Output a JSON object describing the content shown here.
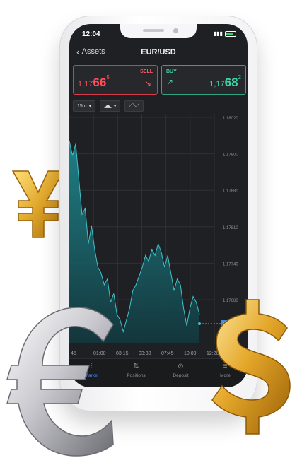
{
  "status": {
    "time": "12:04"
  },
  "nav": {
    "back_label": "Assets",
    "title": "EUR/USD"
  },
  "sell": {
    "label": "SELL",
    "price_prefix": "1,17",
    "price_big": "66",
    "price_sup": "5"
  },
  "buy": {
    "label": "BUY",
    "price_prefix": "1,17",
    "price_big": "68",
    "price_sup": "2"
  },
  "toolbar": {
    "interval": "15m"
  },
  "chart_data": {
    "type": "area",
    "y_ticks": [
      "1.18020",
      "1.17900",
      "1.17880",
      "1.17810",
      "1.17740",
      "1.17680"
    ],
    "x_ticks": [
      "45",
      "01:00",
      "03:15",
      "03:30",
      "07:45",
      "10:09",
      "12:20"
    ],
    "current_label": "1.17664",
    "grid": true,
    "values": [
      1.1795,
      1.179,
      1.1794,
      1.1782,
      1.177,
      1.1772,
      1.176,
      1.1766,
      1.1758,
      1.1752,
      1.175,
      1.1746,
      1.1748,
      1.174,
      1.1743,
      1.1736,
      1.1734,
      1.173,
      1.1734,
      1.1738,
      1.1744,
      1.1746,
      1.1749,
      1.1752,
      1.1756,
      1.1754,
      1.1758,
      1.1756,
      1.176,
      1.1757,
      1.1752,
      1.1756,
      1.175,
      1.1744,
      1.1748,
      1.1746,
      1.1738,
      1.1732,
      1.1738,
      1.1742,
      1.174,
      1.1736
    ]
  },
  "tabs": [
    {
      "label": "Market",
      "icon": "market-icon"
    },
    {
      "label": "Positions",
      "icon": "positions-icon"
    },
    {
      "label": "Deposit",
      "icon": "deposit-icon"
    },
    {
      "label": "More",
      "icon": "more-icon"
    }
  ],
  "colors": {
    "sell": "#d83a4a",
    "buy": "#2ea47f",
    "chart_line": "#3fc3c9",
    "gold": "#e0a72c",
    "silver": "#c9c9cf"
  }
}
